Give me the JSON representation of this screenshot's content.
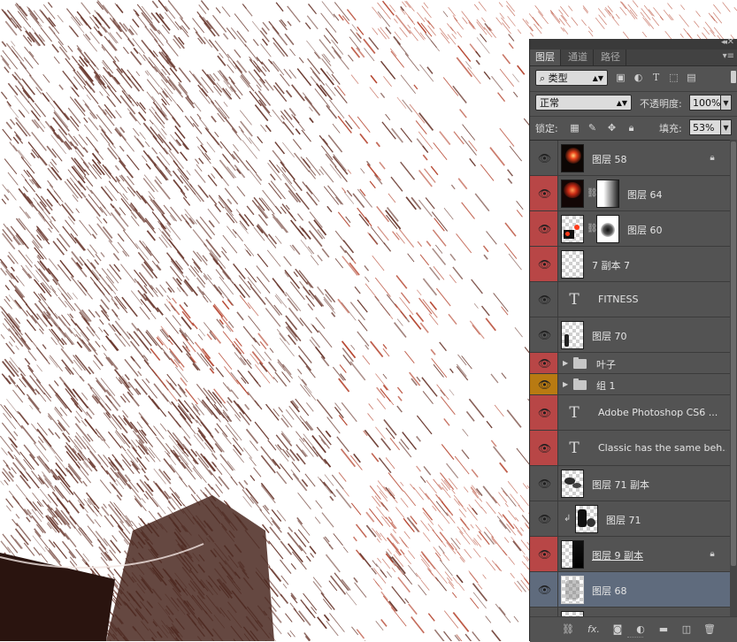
{
  "panel": {
    "tabs": [
      {
        "label": "图层",
        "active": true
      },
      {
        "label": "通道",
        "active": false
      },
      {
        "label": "路径",
        "active": false
      }
    ],
    "filter": {
      "kind_label": "类型",
      "icons": [
        "image-filter-icon",
        "adjustment-filter-icon",
        "type-filter-icon",
        "shape-filter-icon",
        "smart-object-filter-icon"
      ]
    },
    "blend": {
      "mode": "正常",
      "opacity_label": "不透明度:",
      "opacity_value": "100%"
    },
    "lock": {
      "label": "锁定:",
      "icons": [
        "lock-transparent-icon",
        "lock-paint-icon",
        "lock-position-icon",
        "lock-all-icon"
      ],
      "fill_label": "填充:",
      "fill_value": "53%"
    },
    "layers": [
      {
        "name": "图层 58",
        "kind": "pixel",
        "eye": "default",
        "locked": true,
        "thumb": "glow"
      },
      {
        "name": "图层 64",
        "kind": "pixel-mask",
        "eye": "red",
        "thumb": "glow-dark",
        "mask": "soft-right"
      },
      {
        "name": "图层 60",
        "kind": "pixel-mask",
        "eye": "red",
        "thumb": "spots",
        "mask": "blob"
      },
      {
        "name": "7 副本 7",
        "kind": "pixel",
        "eye": "red",
        "thumb": "empty"
      },
      {
        "name": "FITNESS",
        "kind": "type",
        "eye": "default"
      },
      {
        "name": "图层 70",
        "kind": "pixel",
        "eye": "default",
        "thumb": "figure"
      },
      {
        "name": "叶子",
        "kind": "group",
        "eye": "red"
      },
      {
        "name": "组 1",
        "kind": "group",
        "eye": "orange"
      },
      {
        "name": "Adobe  Photoshop  CS6 ...",
        "kind": "type",
        "eye": "red"
      },
      {
        "name": "Classic has the same beh...",
        "kind": "type",
        "eye": "red"
      },
      {
        "name": "图层 71 副本",
        "kind": "pixel",
        "eye": "default",
        "thumb": "splash"
      },
      {
        "name": "图层 71",
        "kind": "pixel-clipped",
        "eye": "default",
        "thumb": "splash-dark"
      },
      {
        "name": "图层 9 副本",
        "kind": "pixel",
        "eye": "red",
        "locked": true,
        "underlined": true,
        "thumb": "dark-right"
      },
      {
        "name": "图层 68",
        "kind": "pixel",
        "eye": "default",
        "selected": true,
        "thumb": "grey"
      }
    ],
    "bottom_icons": [
      "link-layers-icon",
      "fx-icon",
      "add-mask-icon",
      "adjustment-layer-icon",
      "new-group-icon",
      "new-layer-icon",
      "delete-layer-icon"
    ],
    "bottom_fx_label": "fx."
  },
  "colors": {
    "canvas_stroke": "#6b3a30",
    "canvas_accent": "#b5442e",
    "panel_bg": "#535353",
    "eye_red": "#b84646",
    "eye_orange": "#b87a12",
    "selected_row": "#5f6b7d"
  }
}
